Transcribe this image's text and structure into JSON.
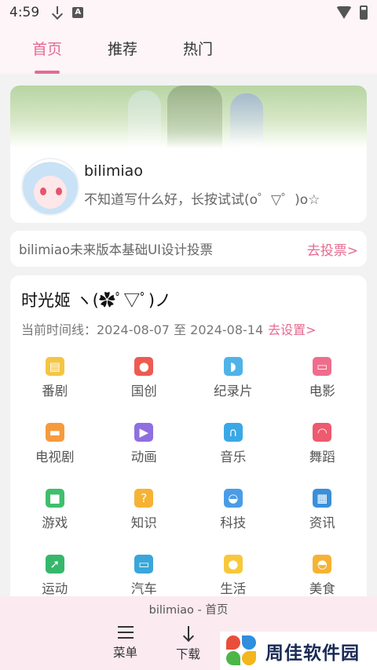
{
  "status_bar": {
    "time": "4:59",
    "a_badge": "A"
  },
  "tabs": [
    {
      "label": "首页",
      "active": true
    },
    {
      "label": "推荐",
      "active": false
    },
    {
      "label": "热门",
      "active": false
    }
  ],
  "profile": {
    "name": "bilimiao",
    "signature": "不知道写什么好，长按试试(o゜▽゜)o☆"
  },
  "vote": {
    "text": "bilimiao未来版本基础UI设计投票",
    "link": "去投票>"
  },
  "timeline": {
    "title": "时光姬 ヽ(✿ﾟ▽ﾟ)ノ",
    "range_label": "当前时间线：2024-08-07 至 2024-08-14",
    "set_link": "去设置>",
    "categories": [
      {
        "label": "番剧",
        "icon": "tv-icon",
        "color": "#f5c542"
      },
      {
        "label": "国创",
        "icon": "peach-icon",
        "color": "#ee5a52"
      },
      {
        "label": "纪录片",
        "icon": "whale-icon",
        "color": "#4fb3e8"
      },
      {
        "label": "电影",
        "icon": "3d-glasses-icon",
        "color": "#ef6d8c"
      },
      {
        "label": "电视剧",
        "icon": "sofa-icon",
        "color": "#f79a3e"
      },
      {
        "label": "动画",
        "icon": "play-icon",
        "color": "#8f6fe0"
      },
      {
        "label": "音乐",
        "icon": "headphones-icon",
        "color": "#3aa8e6"
      },
      {
        "label": "舞蹈",
        "icon": "fan-icon",
        "color": "#ee5a6e"
      },
      {
        "label": "游戏",
        "icon": "creeper-icon",
        "color": "#3fbf6b"
      },
      {
        "label": "知识",
        "icon": "bulb-icon",
        "color": "#f5b335"
      },
      {
        "label": "科技",
        "icon": "ufo-icon",
        "color": "#4a9ce8"
      },
      {
        "label": "资讯",
        "icon": "newspaper-icon",
        "color": "#3a8fd9"
      },
      {
        "label": "运动",
        "icon": "runner-icon",
        "color": "#35b86b"
      },
      {
        "label": "汽车",
        "icon": "car-icon",
        "color": "#3aa6d9"
      },
      {
        "label": "生活",
        "icon": "duck-icon",
        "color": "#f7c83a"
      },
      {
        "label": "美食",
        "icon": "food-icon",
        "color": "#f5b335"
      }
    ]
  },
  "bottom_nav": {
    "page_title": "bilimiao - 首页",
    "menu_label": "菜单",
    "download_label": "下载"
  },
  "watermark": {
    "text": "周佳软件园"
  },
  "colors": {
    "accent": "#e56b91",
    "tab_bg": "#fdf5f8",
    "bottom_bg": "#fce9f0"
  }
}
